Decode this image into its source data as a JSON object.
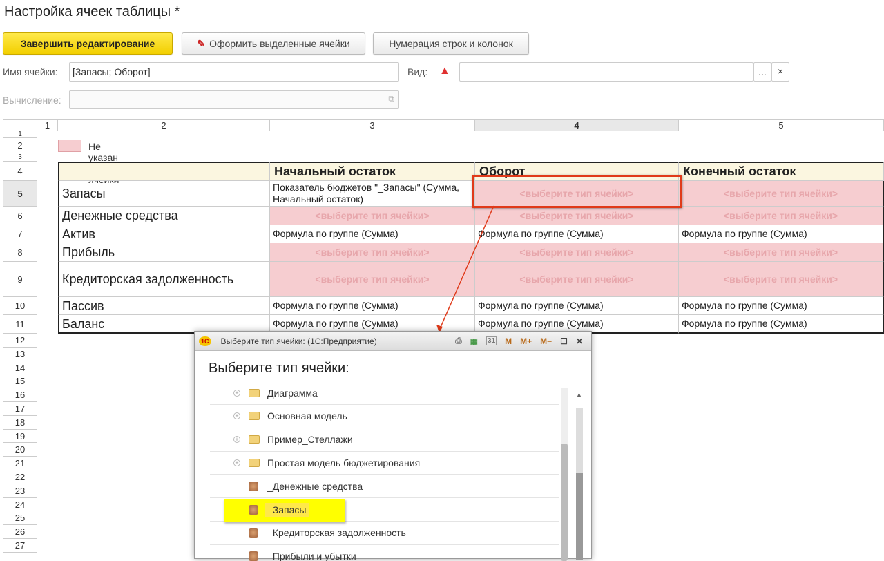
{
  "page": {
    "title": "Настройка ячеек таблицы *"
  },
  "toolbar": {
    "finish": "Завершить редактирование",
    "format": "Оформить выделенные ячейки",
    "numbering": "Нумерация строк и колонок"
  },
  "form": {
    "cell_name_label": "Имя ячейки:",
    "cell_name_value": "[Запасы; Оборот]",
    "kind_label": "Вид:",
    "kind_value": "",
    "calc_label": "Вычисление:",
    "calc_value": "",
    "select_btn": "...",
    "clear_btn": "×"
  },
  "grid": {
    "col_headers": [
      "1",
      "2",
      "3",
      "4",
      "5"
    ],
    "row_numbers": [
      "1",
      "2",
      "3",
      "4",
      "5",
      "6",
      "7",
      "8",
      "9",
      "10",
      "11",
      "12",
      "13",
      "14",
      "15",
      "16",
      "17",
      "18",
      "19",
      "20",
      "21",
      "22",
      "23",
      "24",
      "25",
      "26",
      "27"
    ],
    "legend": "Не указан вид ячейки",
    "headers": [
      "Начальный остаток",
      "Оборот",
      "Конечный остаток"
    ],
    "placeholder": "<выберите тип ячейки>",
    "rows": [
      {
        "name": "Запасы",
        "c3": "Показатель бюджетов \"_Запасы\" (Сумма, Начальный остаток)"
      },
      {
        "name": "Денежные средства"
      },
      {
        "name": "Актив",
        "c3": "Формула по группе (Сумма)",
        "c4": "Формула по группе (Сумма)",
        "c5": "Формула по группе (Сумма)"
      },
      {
        "name": "Прибыль"
      },
      {
        "name": "Кредиторская задолженность"
      },
      {
        "name": "Пассив",
        "c3": "Формула по группе (Сумма)",
        "c4": "Формула по группе (Сумма)",
        "c5": "Формула по группе (Сумма)"
      },
      {
        "name": "Баланс",
        "c3": "Формула по группе (Сумма)",
        "c4": "Формула по группе (Сумма)",
        "c5": "Формула по группе (Сумма)"
      }
    ]
  },
  "dialog": {
    "window_title": "Выберите тип ячейки:  (1С:Предприятие)",
    "logo": "1С",
    "m": "M",
    "mplus": "M+",
    "mminus": "M−",
    "heading": "Выберите тип ячейки:",
    "items": [
      {
        "label": "Диаграмма",
        "type": "folder"
      },
      {
        "label": "Основная модель",
        "type": "folder"
      },
      {
        "label": "Пример_Стеллажи",
        "type": "folder"
      },
      {
        "label": "Простая модель бюджетирования",
        "type": "folder"
      },
      {
        "label": "_Денежные средства",
        "type": "indicator"
      },
      {
        "label": "_Запасы",
        "type": "indicator",
        "highlighted": true
      },
      {
        "label": "_Кредиторская задолженность",
        "type": "indicator"
      },
      {
        "label": "_Прибыли и убытки",
        "type": "indicator"
      }
    ]
  },
  "colors": {
    "accent": "#f2cf00",
    "unset_cell": "#f6cdd0",
    "selection": "#e03a1a",
    "highlight": "#ffff00"
  }
}
